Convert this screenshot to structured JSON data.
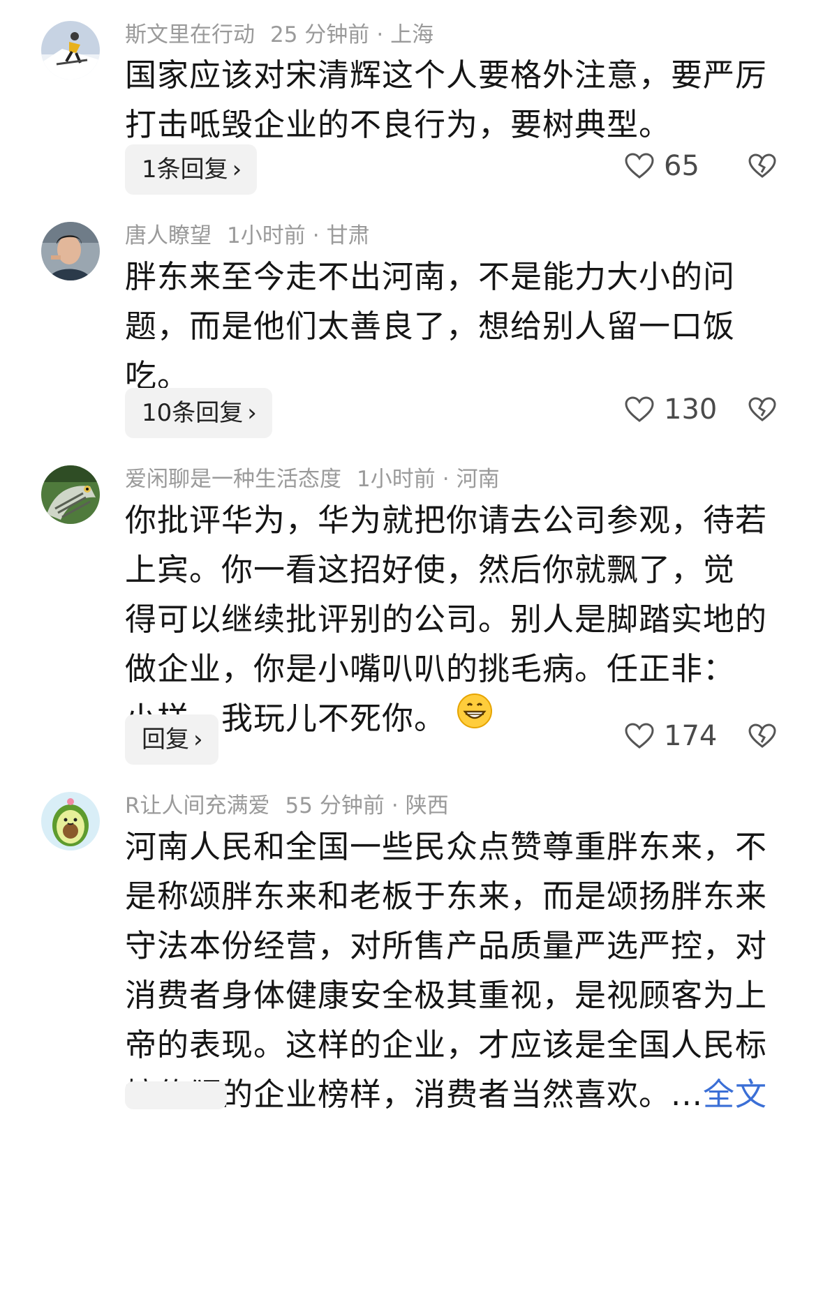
{
  "comments": [
    {
      "username": "斯文里在行动",
      "time": "25 分钟前",
      "location": "上海",
      "text_lines": [
        "国家应该对宋清辉这个人要格外注意，要严厉",
        "打击呧毁企业的不良行为，要树典型。"
      ],
      "reply_label": "1条回复",
      "likes": "65",
      "avatar_icon": "skier-avatar"
    },
    {
      "username": "唐人瞭望",
      "time": "1小时前",
      "location": "甘肃",
      "text_lines": [
        "胖东来至今走不出河南，不是能力大小的问",
        "题，而是他们太善良了，想给别人留一口饭",
        "吃。"
      ],
      "reply_label": "10条回复",
      "likes": "130",
      "avatar_icon": "man-portrait-avatar"
    },
    {
      "username": "爱闲聊是一种生活态度",
      "time": "1小时前",
      "location": "河南",
      "text_lines": [
        "你批评华为，华为就把你请去公司参观，待若",
        "上宾。你一看这招好使，然后你就飘了，觉",
        "得可以继续批评别的公司。别人是脚踏实地的",
        "做企业，你是小嘴叭叭的挑毛病。任正非：",
        "小样，我玩儿不死你。"
      ],
      "emoji": "grinning-face-emoji",
      "reply_label": "回复",
      "likes": "174",
      "avatar_icon": "eagle-avatar"
    },
    {
      "username": "R让人间充满爱",
      "time": "55 分钟前",
      "location": "陕西",
      "text_lines": [
        "河南人民和全国一些民众点赞尊重胖东来，不",
        "是称颂胖东来和老板于东来，而是颂扬胖东来",
        "守法本份经营，对所售产品质量严选严控，对",
        "消费者身体健康安全极其重视，是视顾客为上",
        "帝的表现。这样的企业，才应该是全国人民标",
        "榜传颂的企业榜样，消费者当然喜欢。"
      ],
      "ellipsis": "...",
      "more_label": "全文",
      "avatar_icon": "avocado-avatar"
    }
  ],
  "dot": "·",
  "chevron": "›",
  "colors": {
    "meta": "#9a9a9a",
    "link": "#3b6fd6",
    "reply_bg": "#f2f2f2"
  }
}
